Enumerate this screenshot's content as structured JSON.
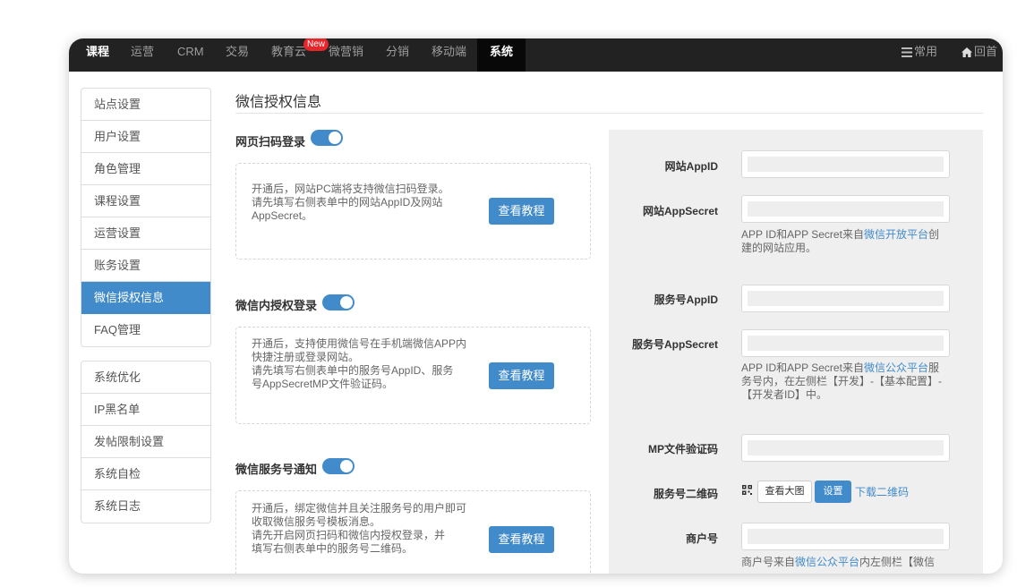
{
  "nav": {
    "items": [
      "课程",
      "运营",
      "CRM",
      "交易",
      "教育云",
      "微营销",
      "分销",
      "移动端",
      "系统"
    ],
    "new_badge": "New",
    "right": [
      "常用",
      "回首"
    ]
  },
  "sidebar": {
    "group1": [
      "站点设置",
      "用户设置",
      "角色管理",
      "课程设置",
      "运营设置",
      "账务设置",
      "微信授权信息",
      "FAQ管理"
    ],
    "group2": [
      "系统优化",
      "IP黑名单",
      "发帖限制设置",
      "系统自检",
      "系统日志"
    ],
    "active": "微信授权信息"
  },
  "page": {
    "title": "微信授权信息"
  },
  "sections": [
    {
      "title": "网页扫码登录",
      "enabled": true,
      "desc": [
        "开通后，网站PC端将支持微信扫码登录。",
        "请先填写右侧表单中的网站AppID及网站",
        "AppSecret。"
      ],
      "button": "查看教程"
    },
    {
      "title": "微信内授权登录",
      "enabled": true,
      "desc": [
        "开通后，支持使用微信号在手机端微信APP内",
        "快捷注册或登录网站。",
        "请先填写右侧表单中的服务号AppID、服务",
        "号AppSecretMP文件验证码。"
      ],
      "button": "查看教程"
    },
    {
      "title": "微信服务号通知",
      "enabled": true,
      "desc": [
        "开通后，绑定微信并且关注服务号的用户即可",
        "收取微信服务号模板消息。",
        "请先开启网页扫码和微信内授权登录，并",
        "填写右侧表单中的服务号二维码。"
      ],
      "button": "查看教程"
    }
  ],
  "form": {
    "site_appid": "网站AppID",
    "site_appsecret": "网站AppSecret",
    "help1": {
      "pre": "APP ID和APP Secret来自",
      "link": "微信开放平台",
      "post1": "创",
      "post2": "建的网站应用。"
    },
    "service_appid": "服务号AppID",
    "service_appsecret": "服务号AppSecret",
    "help2": {
      "pre": "APP ID和APP Secret来自",
      "link": "微信公众平台",
      "post1": "服",
      "line2": "务号内，在左侧栏【开发】-【基本配置】-",
      "line3": "【开发者ID】中。"
    },
    "mp_file": "MP文件验证码",
    "qrcode": "服务号二维码",
    "view_large": "查看大图",
    "set": "设置",
    "download_qr": "下载二维码",
    "merchant": "商户号",
    "help3": {
      "pre": "商户号来自",
      "link": "微信公众平台",
      "post": "内左侧栏【微信"
    }
  }
}
